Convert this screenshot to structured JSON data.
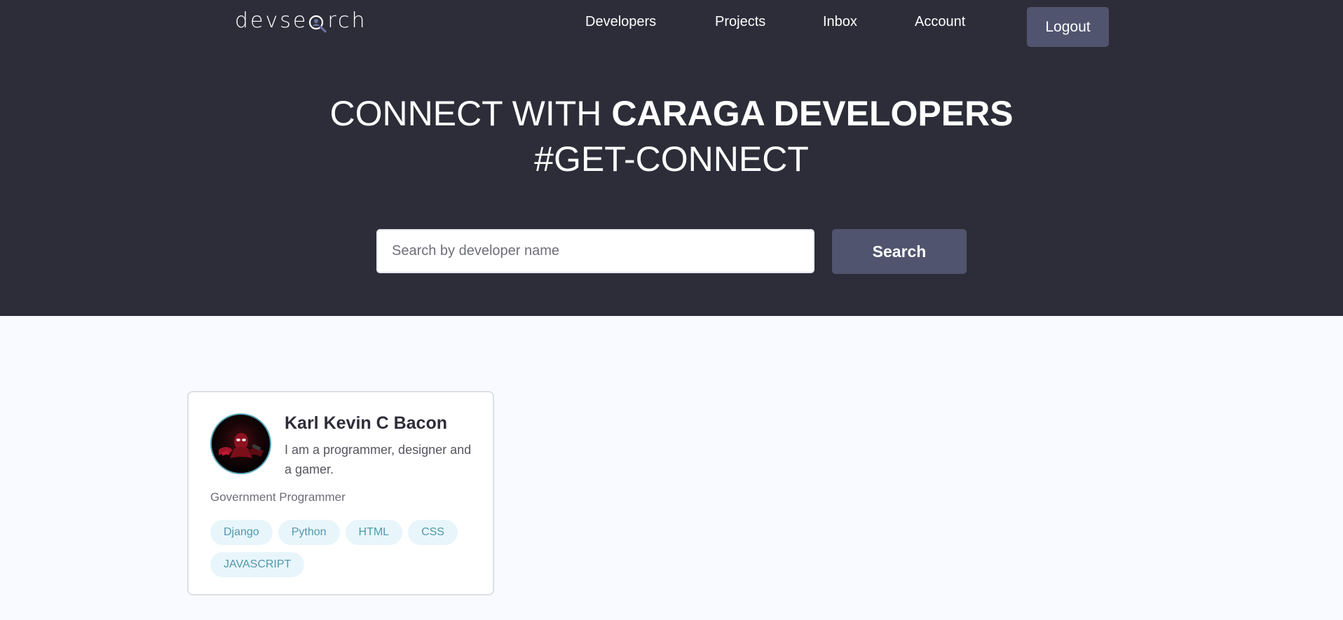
{
  "brand": {
    "logo_before": "devse",
    "logo_after": "rch",
    "colors": {
      "header_bg": "#2d2d39",
      "accent": "#51546e",
      "tag_bg": "#e8f6fb",
      "tag_text": "#5297ad",
      "page_bg": "#f8faff"
    }
  },
  "nav": {
    "items": [
      {
        "label": "Developers"
      },
      {
        "label": "Projects"
      },
      {
        "label": "Inbox"
      },
      {
        "label": "Account"
      }
    ],
    "logout_label": "Logout"
  },
  "hero": {
    "line1_light": "CONNECT WITH ",
    "line1_bold": "CARAGA DEVELOPERS",
    "line2": "#GET-CONNECT"
  },
  "search": {
    "placeholder": "Search by developer name",
    "value": "",
    "button_label": "Search"
  },
  "developers": [
    {
      "name": "Karl Kevin C Bacon",
      "bio": "I am a programmer, designer and a gamer.",
      "title": "Government Programmer",
      "avatar_icon": "spiderman-avatar",
      "skills": [
        "Django",
        "Python",
        "HTML",
        "CSS",
        "JAVASCRIPT"
      ]
    }
  ]
}
